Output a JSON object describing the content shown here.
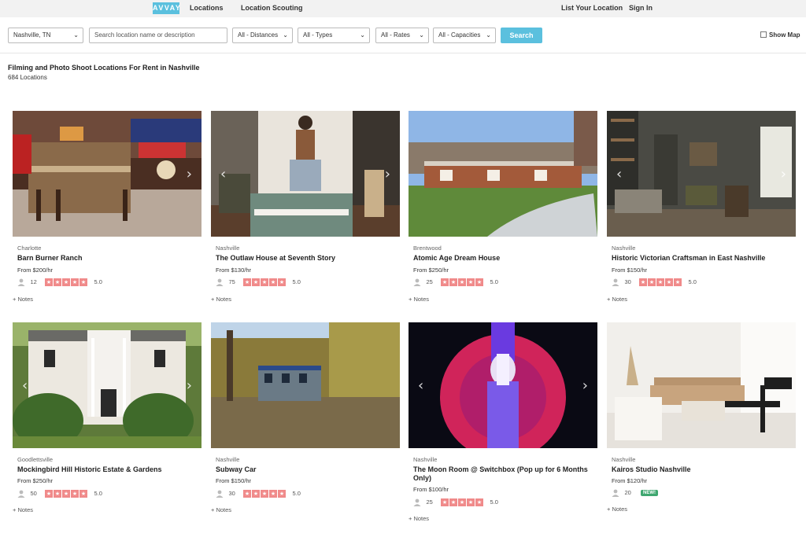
{
  "nav": {
    "logo": "AVVAY",
    "locations": "Locations",
    "scouting": "Location Scouting",
    "list": "List Your Location",
    "signin": "Sign In"
  },
  "search": {
    "city": "Nashville, TN",
    "placeholder": "Search location name or description",
    "distance": "All - Distances",
    "types": "All - Types",
    "rates": "All - Rates",
    "capacities": "All - Capacities",
    "button": "Search",
    "show_map": "Show Map"
  },
  "results": {
    "heading": "Filming and Photo Shoot Locations For Rent in Nashville",
    "count": "684 Locations"
  },
  "labels": {
    "notes": "+ Notes",
    "new": "NEW!"
  },
  "cards": [
    {
      "city": "Charlotte",
      "title": "Barn Burner Ranch",
      "price": "From $200/hr",
      "capacity": "12",
      "score": "5.0"
    },
    {
      "city": "Nashville",
      "title": "The Outlaw House at Seventh Story",
      "price": "From $130/hr",
      "capacity": "75",
      "score": "5.0"
    },
    {
      "city": "Brentwood",
      "title": "Atomic Age Dream House",
      "price": "From $250/hr",
      "capacity": "25",
      "score": "5.0"
    },
    {
      "city": "Nashville",
      "title": "Historic Victorian Craftsman in East Nashville",
      "price": "From $150/hr",
      "capacity": "30",
      "score": "5.0"
    },
    {
      "city": "Goodlettsville",
      "title": "Mockingbird Hill Historic Estate & Gardens",
      "price": "From $250/hr",
      "capacity": "50",
      "score": "5.0"
    },
    {
      "city": "Nashville",
      "title": "Subway Car",
      "price": "From $150/hr",
      "capacity": "30",
      "score": "5.0"
    },
    {
      "city": "Nashville",
      "title": "The Moon Room @ Switchbox (Pop up for 6 Months Only)",
      "price": "From $100/hr",
      "capacity": "25",
      "score": "5.0"
    },
    {
      "city": "Nashville",
      "title": "Kairos Studio Nashville",
      "price": "From $120/hr",
      "capacity": "20",
      "score": ""
    }
  ]
}
